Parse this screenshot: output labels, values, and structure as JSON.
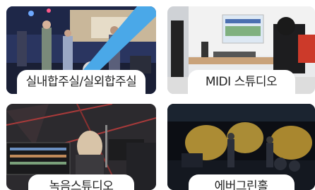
{
  "cards": [
    {
      "label": "실내합주실/실외합주실"
    },
    {
      "label": "MIDI 스튜디오"
    },
    {
      "label": "녹음스튜디오"
    },
    {
      "label": "에버그린홀"
    }
  ],
  "colors": {
    "accent": "#4aa8e8",
    "card1_bg": "#2a3560",
    "card2_bg": "#e9eaec",
    "card3_bg": "#2c2a2e",
    "card4_bg": "#0c0e14"
  }
}
